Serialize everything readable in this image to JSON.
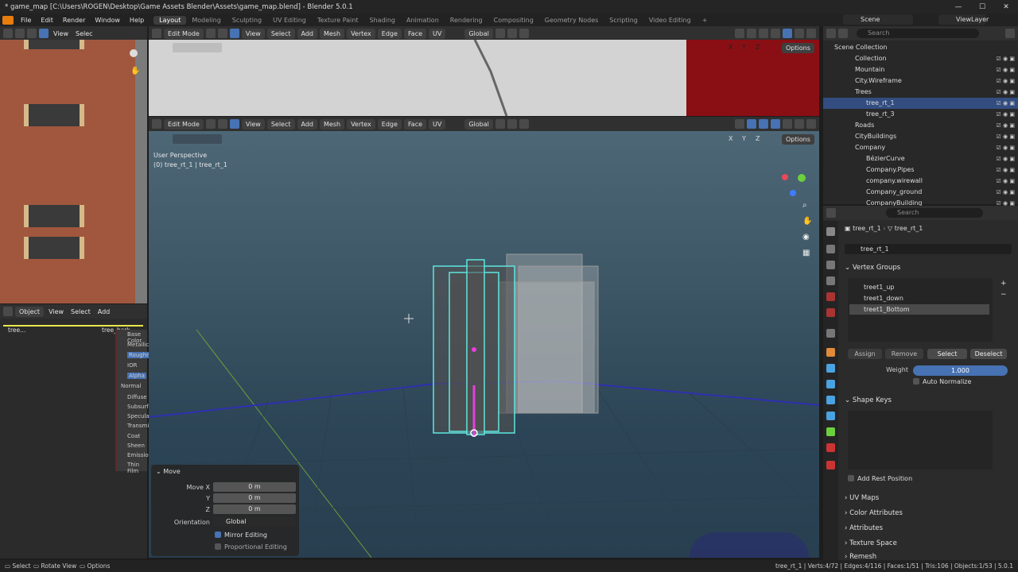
{
  "window": {
    "title": "* game_map [C:\\Users\\ROGEN\\Desktop\\Game Assets Blender\\Assets\\game_map.blend] - Blender 5.0.1",
    "min": "—",
    "max": "☐",
    "close": "✕"
  },
  "menus": [
    "File",
    "Edit",
    "Render",
    "Window",
    "Help"
  ],
  "workspaces": [
    "Layout",
    "Modeling",
    "Sculpting",
    "UV Editing",
    "Texture Paint",
    "Shading",
    "Animation",
    "Rendering",
    "Compositing",
    "Geometry Nodes",
    "Scripting",
    "Video Editing"
  ],
  "active_workspace": "Layout",
  "scene": "Scene",
  "view_layer": "ViewLayer",
  "uv_header": {
    "view": "View",
    "select": "Selec"
  },
  "viewport_header": {
    "mode": "Edit Mode",
    "view": "View",
    "select": "Select",
    "add": "Add",
    "mesh": "Mesh",
    "vertex": "Vertex",
    "edge": "Edge",
    "face": "Face",
    "uv": "UV",
    "orientation": "Global",
    "options": "Options",
    "x": "X",
    "y": "Y",
    "z": "Z"
  },
  "viewport": {
    "perspective": "User Perspective",
    "object_info": "(0) tree_rt_1 | tree_rt_1"
  },
  "node_header": {
    "object": "Object",
    "view": "View",
    "select": "Select",
    "add": "Add"
  },
  "node_tree": {
    "node_a": "tree...",
    "node_b": "tree_bark"
  },
  "node_sockets": [
    "Base Color",
    "Metallic",
    "Roughness",
    "IOR",
    "Alpha",
    "Normal",
    "Diffuse",
    "Subsurface",
    "Specular",
    "Transmission",
    "Coat",
    "Sheen",
    "Emission",
    "Thin Film"
  ],
  "move_panel": {
    "title": "Move",
    "move_x_label": "Move X",
    "y_label": "Y",
    "z_label": "Z",
    "x": "0 m",
    "y": "0 m",
    "z": "0 m",
    "orientation_label": "Orientation",
    "orientation": "Global",
    "mirror": "Mirror Editing",
    "proportional": "Proportional Editing"
  },
  "outliner": {
    "search_placeholder": "Search",
    "root": "Scene Collection",
    "rows": [
      {
        "name": "Collection",
        "indent": 1
      },
      {
        "name": "Mountain",
        "indent": 1
      },
      {
        "name": "City.Wireframe",
        "indent": 1
      },
      {
        "name": "Trees",
        "indent": 1
      },
      {
        "name": "tree_rt_1",
        "indent": 2,
        "selected": true
      },
      {
        "name": "tree_rt_3",
        "indent": 2
      },
      {
        "name": "Roads",
        "indent": 1
      },
      {
        "name": "CityBuildings",
        "indent": 1
      },
      {
        "name": "Company",
        "indent": 1
      },
      {
        "name": "BézierCurve",
        "indent": 2
      },
      {
        "name": "Company.Pipes",
        "indent": 2
      },
      {
        "name": "company.wirewall",
        "indent": 2
      },
      {
        "name": "Company_ground",
        "indent": 2
      },
      {
        "name": "CompanyBuilding",
        "indent": 2
      }
    ]
  },
  "properties": {
    "search_placeholder": "Search",
    "breadcrumb_object": "tree_rt_1",
    "breadcrumb_mesh": "tree_rt_1",
    "mesh_name": "tree_rt_1",
    "vertex_groups_title": "Vertex Groups",
    "vertex_groups": [
      "treet1_up",
      "treet1_down",
      "treet1_Bottom"
    ],
    "assign": "Assign",
    "remove": "Remove",
    "select": "Select",
    "deselect": "Deselect",
    "weight_label": "Weight",
    "weight": "1.000",
    "auto_normalize": "Auto Normalize",
    "shape_keys_title": "Shape Keys",
    "add_rest_position": "Add Rest Position",
    "sections": [
      "UV Maps",
      "Color Attributes",
      "Attributes",
      "Texture Space",
      "Remesh"
    ]
  },
  "status": {
    "select": "Select",
    "rotate": "Rotate View",
    "options": "Options",
    "stats": "tree_rt_1 | Verts:4/72 | Edges:4/116 | Faces:1/51 | Tris:106 | Objects:1/53 | 5.0.1"
  },
  "colors": {
    "accent": "#4772b3",
    "selected_row": "#334d80",
    "wire": "#5fe6e0",
    "edge_select": "#e83ddf"
  }
}
